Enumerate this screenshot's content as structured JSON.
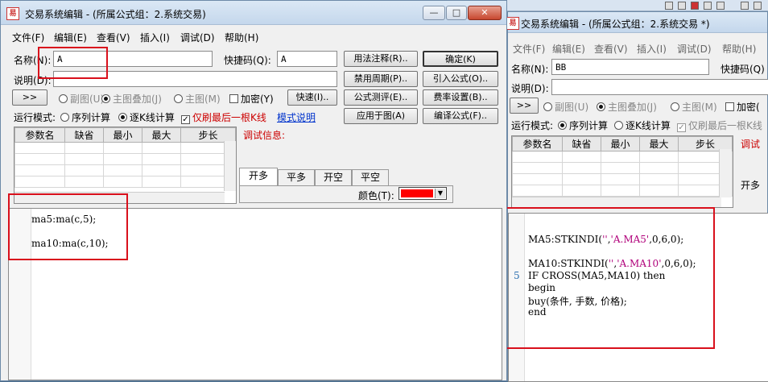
{
  "window_left": {
    "title": "交易系统编辑 - (所属公式组：2.系统交易)",
    "controls": {
      "minimize": "—",
      "maximize": "□",
      "close": "✕"
    },
    "menu": [
      "文件(F)",
      "编辑(E)",
      "查看(V)",
      "插入(I)",
      "调试(D)",
      "帮助(H)"
    ],
    "name_label": "名称(N):",
    "name_value": "A",
    "shortcut_label": "快捷码(Q):",
    "shortcut_value": "A",
    "desc_label": "说明(D):",
    "desc_value": "",
    "btn_usage_note": "用法注释(R)..",
    "btn_ok": "确定(K)",
    "btn_disable_period": "禁用周期(P)..",
    "btn_import_formula": "引入公式(O)..",
    "btn_formula_test": "公式测评(E)..",
    "btn_fee_settings": "费率设置(B)..",
    "btn_apply_chart": "应用于图(A)",
    "btn_compile": "编译公式(F)..",
    "btn_expand": ">>",
    "radio_sub_chart": "副图(U)",
    "radio_main_overlay": "主图叠加(J)",
    "radio_main_chart": "主图(M)",
    "check_encrypt": "加密(Y)",
    "btn_quick": "快速(I)..",
    "run_mode_label": "运行模式:",
    "radio_sequence": "序列计算",
    "radio_bar_by_bar": "逐K线计算",
    "check_last_bar": "仅刷最后一根K线",
    "mode_link": "模式说明",
    "param_headers": [
      "参数名",
      "缺省",
      "最小",
      "最大",
      "步长"
    ],
    "debug_label": "调试信息:",
    "tabs": [
      "开多",
      "平多",
      "开空",
      "平空"
    ],
    "color_label": "颜色(T):",
    "color_value": "#ff0000",
    "code_lines": [
      "ma5:ma(c,5);",
      "",
      "ma10:ma(c,10);"
    ]
  },
  "window_right": {
    "title": "交易系统编辑 - (所属公式组：2.系统交易 *)",
    "menu": [
      "文件(F)",
      "编辑(E)",
      "查看(V)",
      "插入(I)",
      "调试(D)",
      "帮助(H)"
    ],
    "name_label": "名称(N):",
    "name_value": "BB",
    "shortcut_label": "快捷码(Q)",
    "desc_label": "说明(D):",
    "btn_expand": ">>",
    "radio_sub_chart": "副图(U)",
    "radio_main_overlay": "主图叠加(J)",
    "radio_main_chart": "主图(M)",
    "check_encrypt": "加密(",
    "run_mode_label": "运行模式:",
    "radio_sequence": "序列计算",
    "radio_bar_by_bar": "逐K线计算",
    "check_last_bar": "仅刷最后一根K线",
    "param_headers": [
      "参数名",
      "缺省",
      "最小",
      "最大",
      "步长"
    ],
    "debug_label": "调试",
    "tab_label": "开多",
    "line_number": "5",
    "code": {
      "line1_pre": "MA5:STKINDI(",
      "line1_str1": "''",
      "line1_mid": ",",
      "line1_str2": "'A.MA5'",
      "line1_post": ",0,6,0);",
      "line2_pre": "MA10:STKINDI(",
      "line2_str1": "''",
      "line2_mid": ",",
      "line2_str2": "'A.MA10'",
      "line2_post": ",0,6,0);",
      "line3": "IF CROSS(MA5,MA10) then",
      "line4": "begin",
      "line5": "buy(条件, 手数, 价格);",
      "line6": "end"
    }
  },
  "highlight_color": "#d9101c"
}
